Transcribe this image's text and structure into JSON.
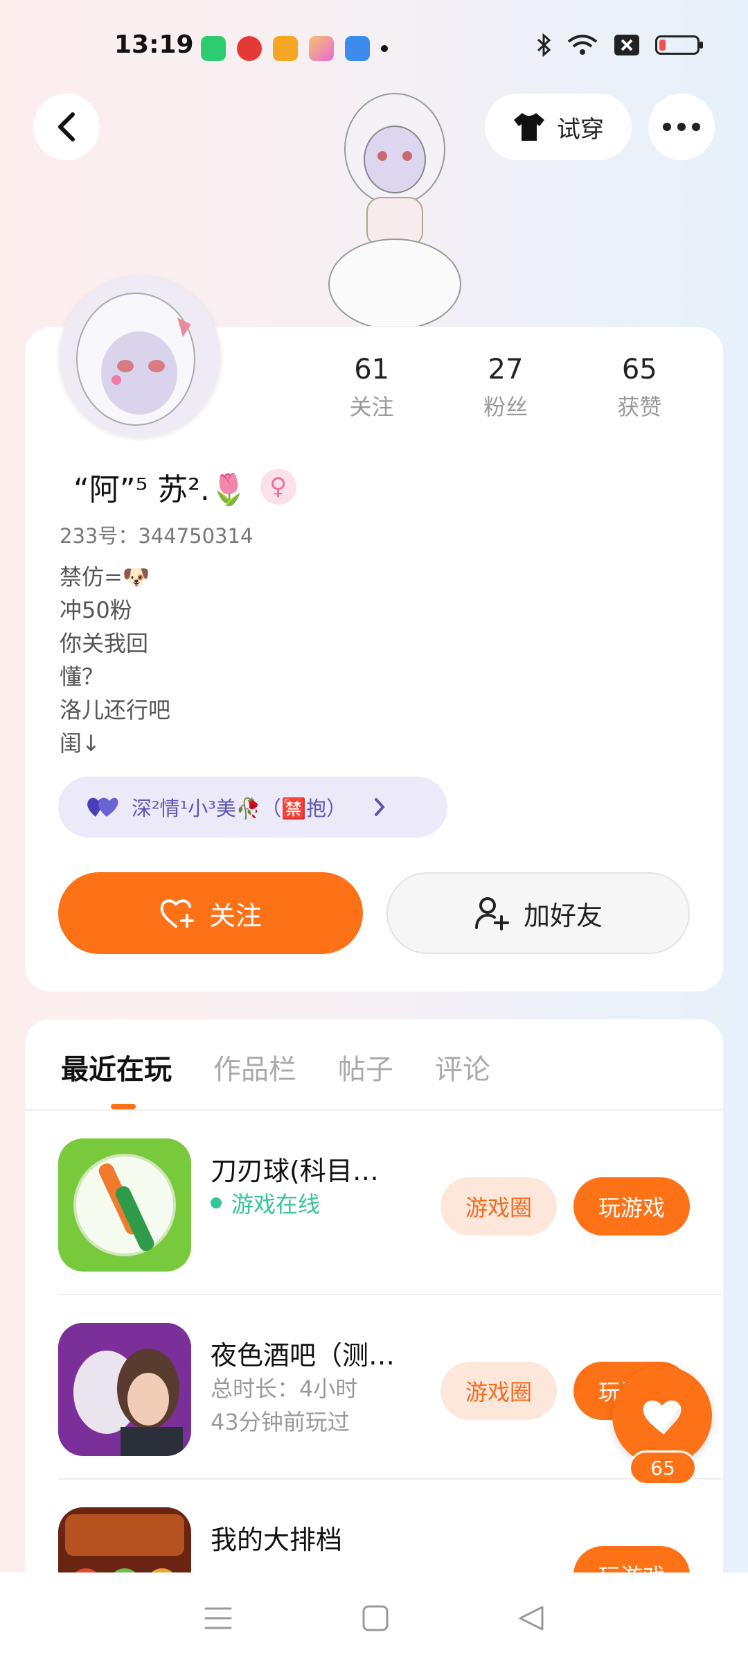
{
  "status_bar": {
    "time": "13:19"
  },
  "header": {
    "try_on_label": "试穿"
  },
  "profile": {
    "stats": [
      {
        "value": "61",
        "label": "关注"
      },
      {
        "value": "27",
        "label": "粉丝"
      },
      {
        "value": "65",
        "label": "获赞"
      }
    ],
    "name": "“阿”⁵ 苏².🌷",
    "uid": "233号：344750314",
    "bio": [
      "禁仿=🐶",
      "冲50粉",
      "你关我回",
      "懂？",
      "洛儿还行吧",
      "闺↓"
    ],
    "tag_label": "深²情¹小³美🥀（🈲抱）",
    "follow_label": "关注",
    "add_friend_label": "加好友"
  },
  "tabs": [
    "最近在玩",
    "作品栏",
    "帖子",
    "评论"
  ],
  "games": [
    {
      "title": "刀刃球(科目…",
      "sub": "游戏在线",
      "sub2": "",
      "circle_label": "游戏圈",
      "play_label": "玩游戏"
    },
    {
      "title": "夜色酒吧（测…",
      "sub": "总时长：4小时",
      "sub2": "43分钟前玩过",
      "circle_label": "游戏圈",
      "play_label": "玩游戏"
    },
    {
      "title": "我的大排档",
      "sub": "",
      "sub2": "",
      "circle_label": "",
      "play_label": "玩游戏"
    }
  ],
  "like_count": "65",
  "colors": {
    "accent": "#fd7117",
    "online": "#33c49b"
  }
}
